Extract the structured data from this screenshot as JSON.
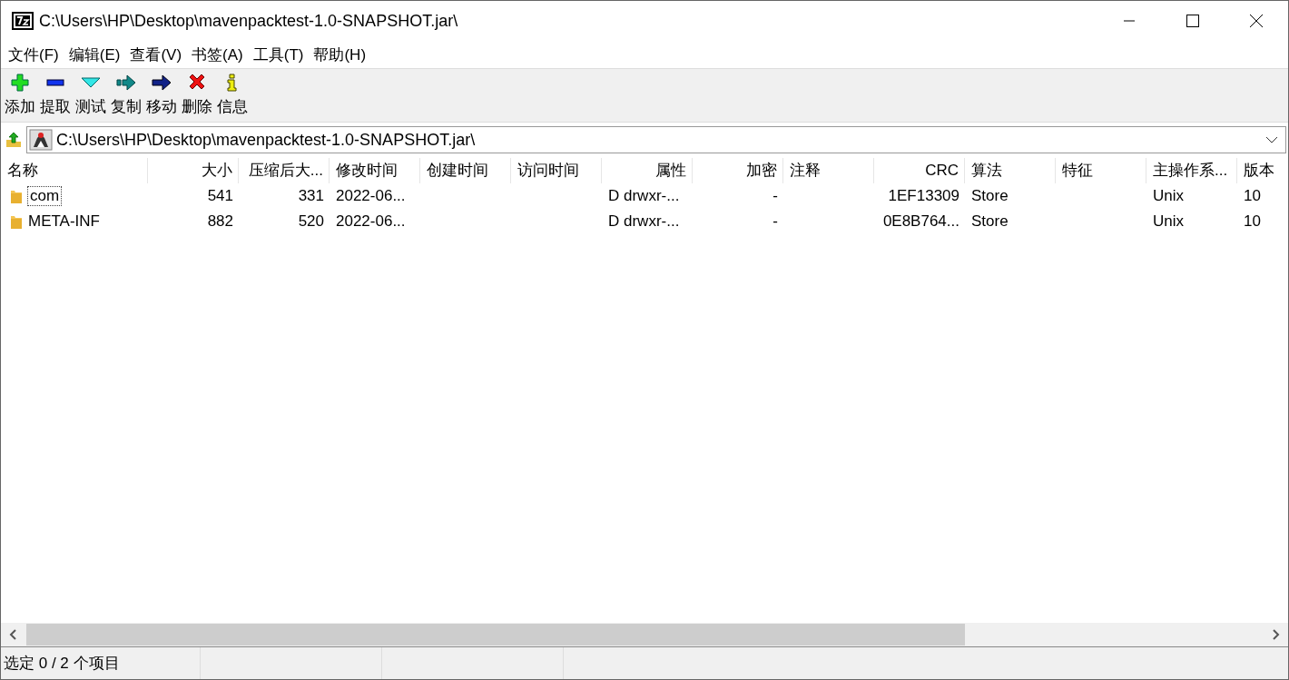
{
  "window": {
    "title": "C:\\Users\\HP\\Desktop\\mavenpacktest-1.0-SNAPSHOT.jar\\"
  },
  "menu": [
    "文件(F)",
    "编辑(E)",
    "查看(V)",
    "书签(A)",
    "工具(T)",
    "帮助(H)"
  ],
  "toolbar": [
    {
      "kind": "add",
      "label": "添加"
    },
    {
      "kind": "extract",
      "label": "提取"
    },
    {
      "kind": "test",
      "label": "测试"
    },
    {
      "kind": "copy",
      "label": "复制"
    },
    {
      "kind": "move",
      "label": "移动"
    },
    {
      "kind": "delete",
      "label": "删除"
    },
    {
      "kind": "info",
      "label": "信息"
    }
  ],
  "address": {
    "value": "C:\\Users\\HP\\Desktop\\mavenpacktest-1.0-SNAPSHOT.jar\\"
  },
  "table": {
    "columns": [
      {
        "label": "名称"
      },
      {
        "label": "大小"
      },
      {
        "label": "压缩后大..."
      },
      {
        "label": "修改时间"
      },
      {
        "label": "创建时间"
      },
      {
        "label": "访问时间"
      },
      {
        "label": "属性"
      },
      {
        "label": "加密"
      },
      {
        "label": "注释"
      },
      {
        "label": "CRC"
      },
      {
        "label": "算法"
      },
      {
        "label": "特征"
      },
      {
        "label": "主操作系..."
      },
      {
        "label": "版本"
      }
    ],
    "rows": [
      {
        "focused": true,
        "cells": [
          "com",
          "541",
          "331",
          "2022-06...",
          "",
          "",
          "D drwxr-...",
          "-",
          "",
          "1EF13309",
          "Store",
          "",
          "Unix",
          "10"
        ]
      },
      {
        "focused": false,
        "cells": [
          "META-INF",
          "882",
          "520",
          "2022-06...",
          "",
          "",
          "D drwxr-...",
          "-",
          "",
          "0E8B764...",
          "Store",
          "",
          "Unix",
          "10"
        ]
      }
    ]
  },
  "status_bar": [
    "选定 0 / 2 个项目"
  ]
}
